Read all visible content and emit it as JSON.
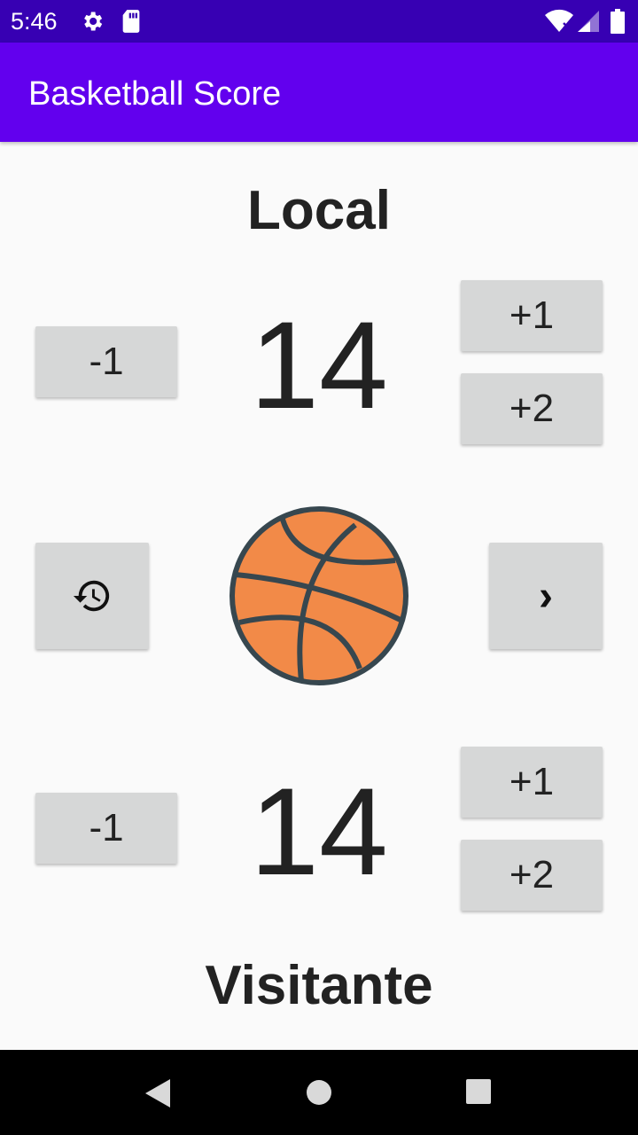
{
  "status_bar": {
    "time": "5:46",
    "icons": [
      "gear-icon",
      "sd-card-icon",
      "wifi-icon",
      "signal-icon",
      "battery-icon"
    ]
  },
  "app_bar": {
    "title": "Basketball Score"
  },
  "local": {
    "label": "Local",
    "score": "14",
    "minus_label": "-1",
    "plus1_label": "+1",
    "plus2_label": "+2"
  },
  "visitor": {
    "label": "Visitante",
    "score": "14",
    "minus_label": "-1",
    "plus1_label": "+1",
    "plus2_label": "+2"
  },
  "controls": {
    "reset_icon": "history-icon",
    "next_label": "›",
    "ball_icon": "basketball-icon"
  },
  "nav_bar": {
    "icons": [
      "back-icon",
      "home-icon",
      "recents-icon"
    ]
  },
  "colors": {
    "status_bar": "#3700b3",
    "app_bar": "#6200ee",
    "button": "#d6d7d7",
    "ball": "#f28a48",
    "ball_lines": "#37474f"
  }
}
